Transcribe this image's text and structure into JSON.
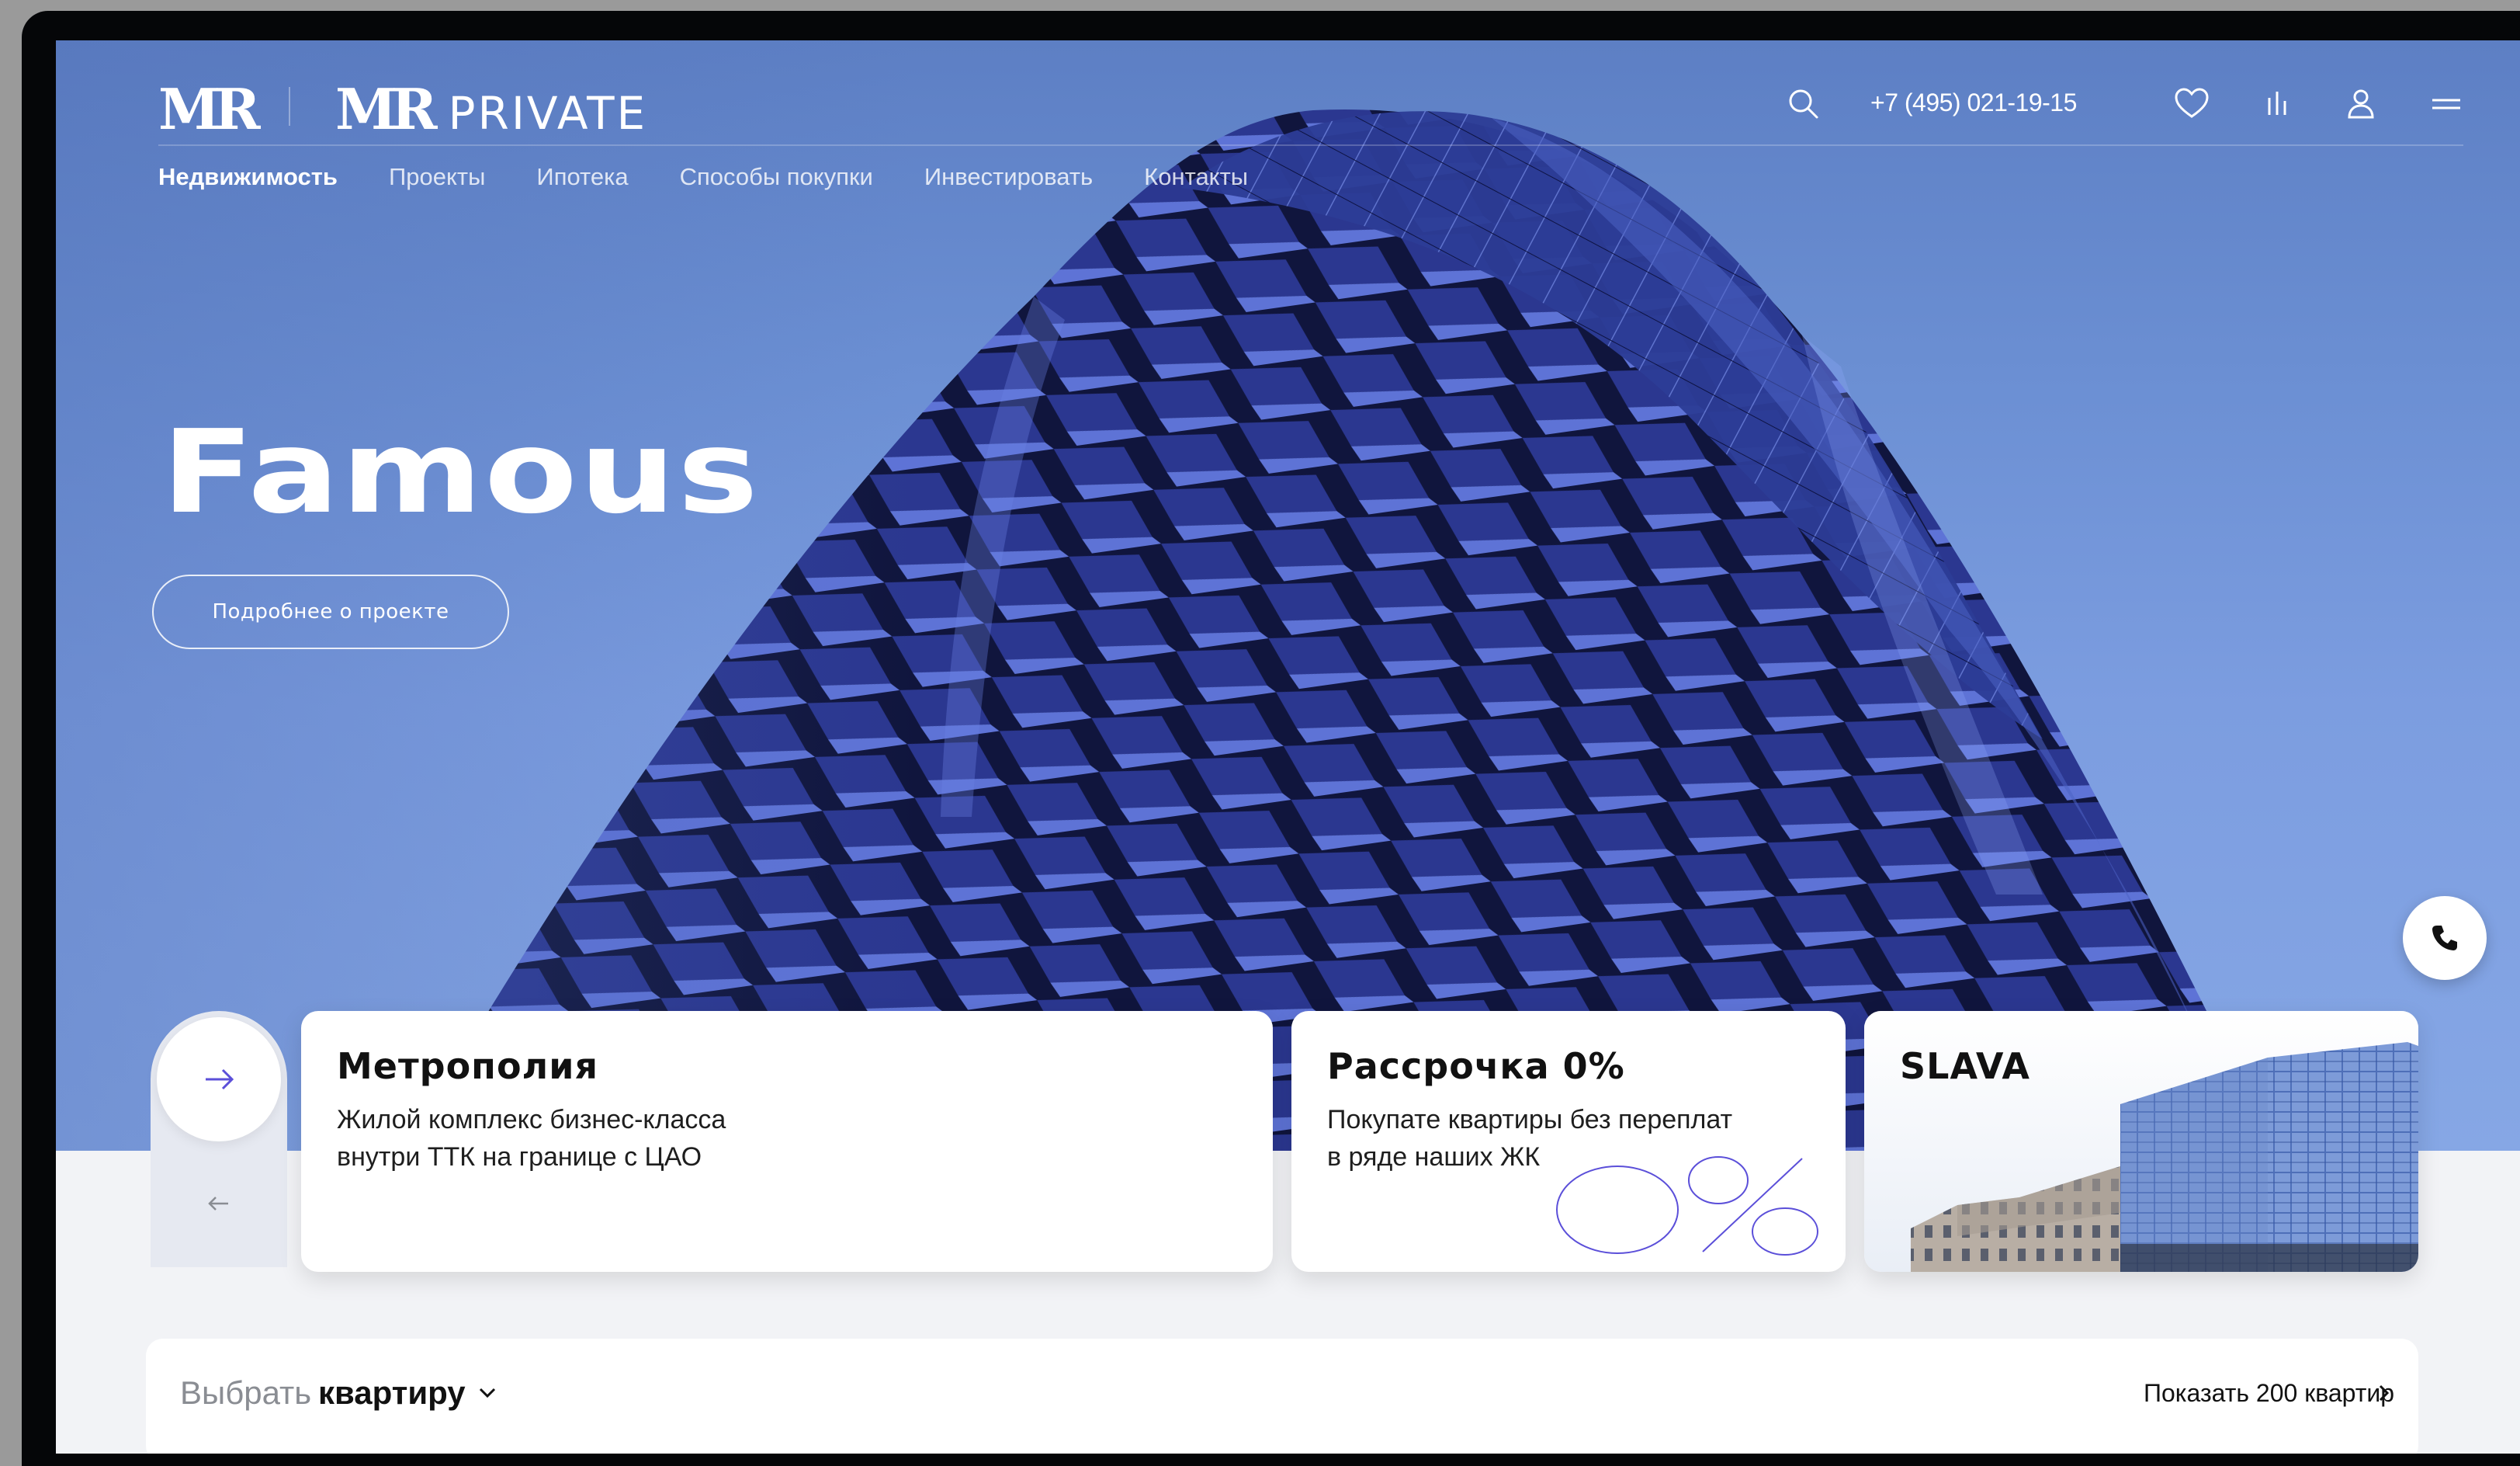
{
  "header": {
    "logo": "MR",
    "brand_mark": "MR",
    "brand_name": "PRIVATE",
    "phone": "+7 (495) 021-19-15",
    "icons": [
      "search-icon",
      "heart-icon",
      "compare-icon",
      "user-icon",
      "menu-icon"
    ]
  },
  "nav": [
    {
      "label": "Недвижимость",
      "active": true
    },
    {
      "label": "Проекты",
      "active": false
    },
    {
      "label": "Ипотека",
      "active": false
    },
    {
      "label": "Способы покупки",
      "active": false
    },
    {
      "label": "Инвестировать",
      "active": false
    },
    {
      "label": "Контакты",
      "active": false
    }
  ],
  "hero": {
    "title": "Famous",
    "button_label": "Подробнее о проекте"
  },
  "cards": [
    {
      "title": "Метрополия",
      "line1": "Жилой комплекс бизнес-класса",
      "line2": "внутри ТТК на границе с ЦАО"
    },
    {
      "title": "Рассрочка 0%",
      "line1": "Покупате квартиры без переплат",
      "line2": "в ряде наших ЖК",
      "graphic": "0%"
    },
    {
      "title": "SLAVA"
    }
  ],
  "select_bar": {
    "label": "Выбрать",
    "value": "квартиру",
    "show_all": "Показать 200 квартир"
  },
  "colors": {
    "accent": "#5b4fd9",
    "hero_sky": "#7c9de0",
    "building": "#1a1e4a"
  }
}
